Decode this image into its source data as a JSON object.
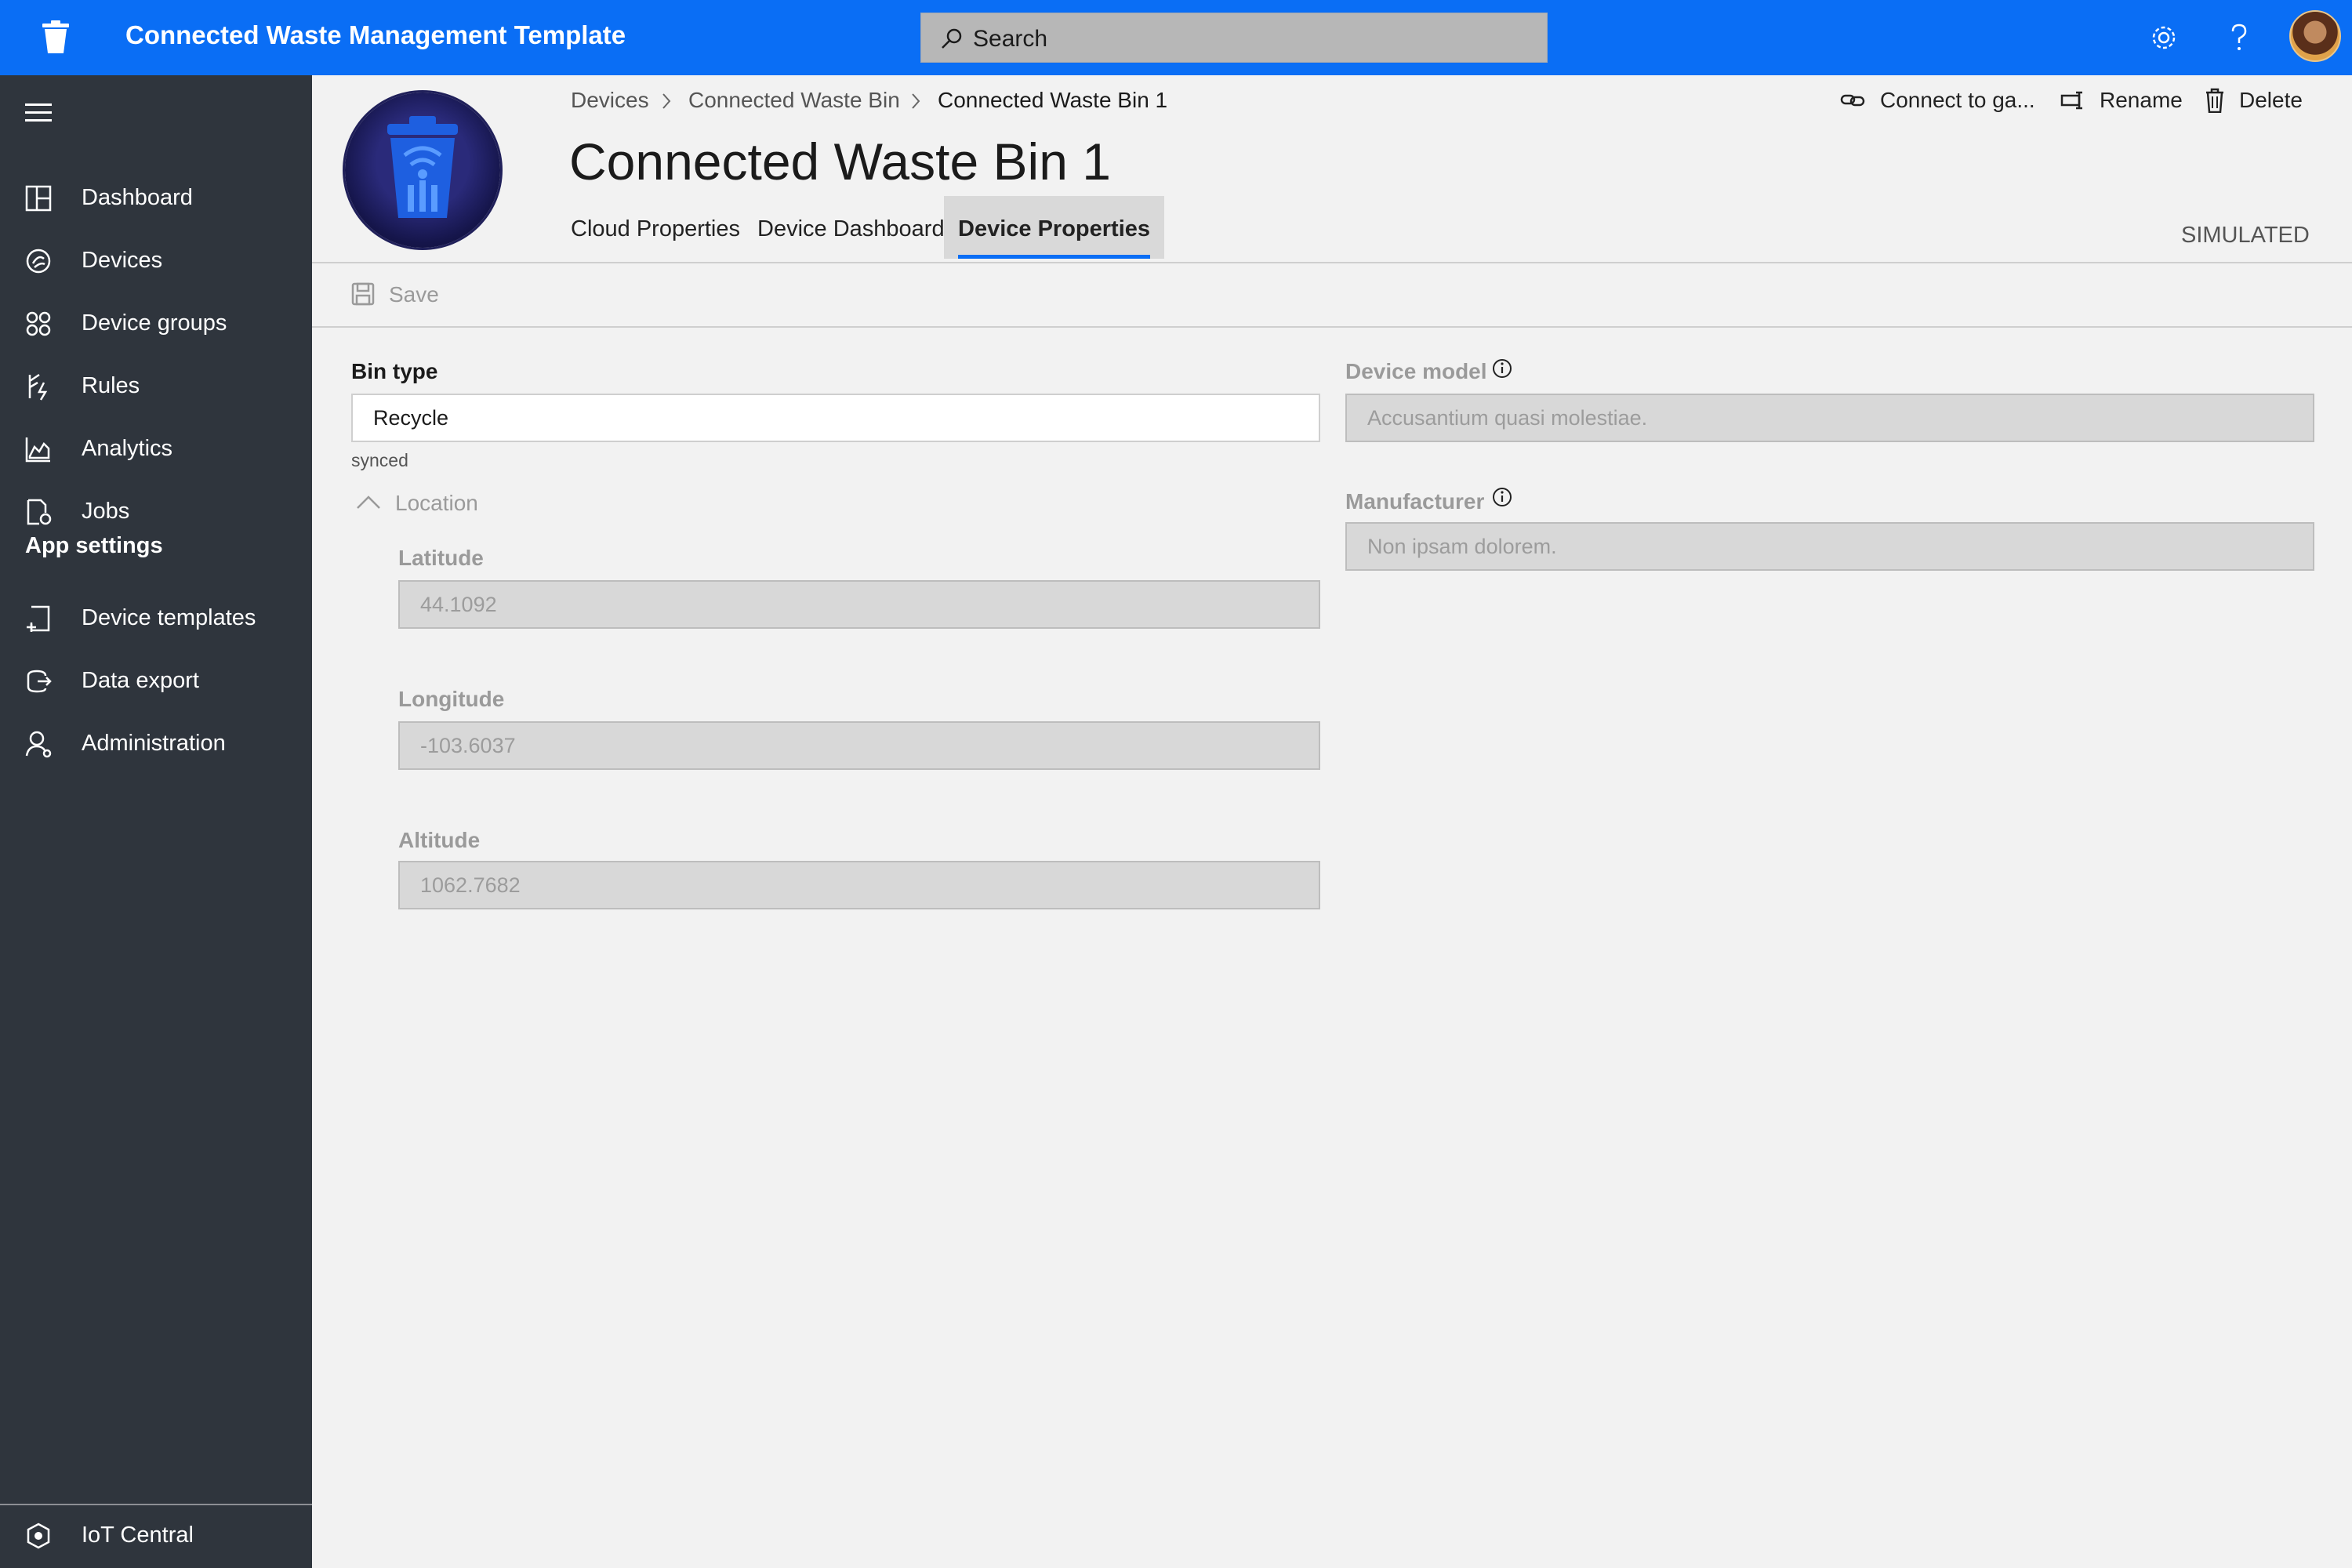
{
  "header": {
    "app_title": "Connected Waste Management Template",
    "search_placeholder": "Search",
    "settings_icon": "gear-icon",
    "help_icon": "question-icon",
    "accent_color": "#0a6ef5"
  },
  "sidebar": {
    "items": [
      {
        "label": "Dashboard",
        "icon": "dashboard-icon"
      },
      {
        "label": "Devices",
        "icon": "devices-icon"
      },
      {
        "label": "Device groups",
        "icon": "device-groups-icon"
      },
      {
        "label": "Rules",
        "icon": "rules-icon"
      },
      {
        "label": "Analytics",
        "icon": "analytics-icon"
      },
      {
        "label": "Jobs",
        "icon": "jobs-icon"
      }
    ],
    "section_title": "App settings",
    "settings_items": [
      {
        "label": "Device templates",
        "icon": "device-templates-icon"
      },
      {
        "label": "Data export",
        "icon": "data-export-icon"
      },
      {
        "label": "Administration",
        "icon": "administration-icon"
      }
    ],
    "footer_label": "IoT Central"
  },
  "device": {
    "breadcrumb": [
      "Devices",
      "Connected Waste Bin",
      "Connected Waste Bin 1"
    ],
    "title": "Connected Waste Bin 1",
    "tabs": [
      "Cloud Properties",
      "Device Dashboard",
      "Device Properties"
    ],
    "active_tab": "Device Properties",
    "status": "SIMULATED",
    "commands": {
      "connect": "Connect to ga...",
      "rename": "Rename",
      "delete": "Delete"
    }
  },
  "toolbar": {
    "save_label": "Save"
  },
  "form": {
    "bin_type": {
      "label": "Bin type",
      "value": "Recycle",
      "status": "synced"
    },
    "location": {
      "label": "Location",
      "latitude": {
        "label": "Latitude",
        "value": "44.1092"
      },
      "longitude": {
        "label": "Longitude",
        "value": "-103.6037"
      },
      "altitude": {
        "label": "Altitude",
        "value": "1062.7682"
      }
    },
    "device_model": {
      "label": "Device model",
      "value": "Accusantium quasi molestiae."
    },
    "manufacturer": {
      "label": "Manufacturer",
      "value": "Non ipsam dolorem."
    }
  }
}
